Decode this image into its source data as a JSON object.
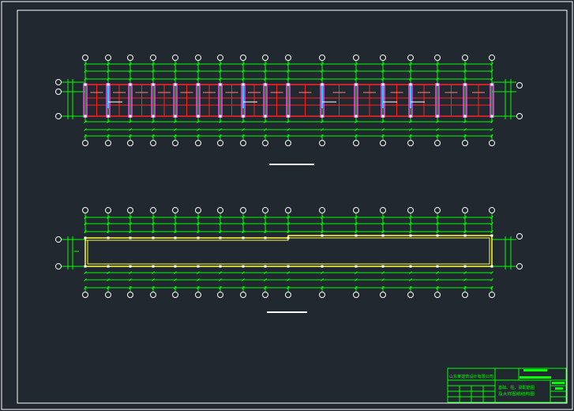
{
  "colors": {
    "background": "#212830",
    "border": "#ffffff",
    "grid": "#00ff00",
    "wall": "#ff2020",
    "column": "#ff40ff",
    "accent": "#00e5e5",
    "beam": "#ffff40",
    "bubble": "#ffffff",
    "titleblock": "#00ff00"
  },
  "plans": [
    {
      "name": "upper-plan",
      "has_rooms": true
    },
    {
      "name": "lower-plan",
      "has_rooms": false
    }
  ],
  "titleblock": {
    "company": "山东某建筑设计有限公司",
    "drawing_title_line1": "基础、柱、梁配筋图",
    "drawing_title_line2": "及大样图纸结构图",
    "text_visible": false
  }
}
